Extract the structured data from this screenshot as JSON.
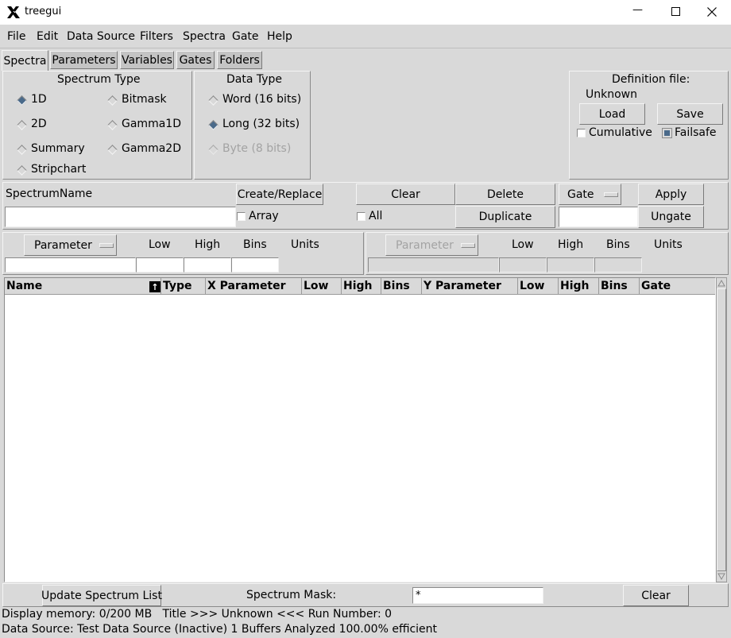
{
  "window": {
    "title": "treegui",
    "minimize_glyph": "—",
    "maximize_glyph": "☐",
    "close_glyph": "✕"
  },
  "menu": [
    "File",
    "Edit",
    "Data Source",
    "Filters",
    "Spectra",
    "Gate",
    "Help"
  ],
  "tabs": [
    "Spectra",
    "Parameters",
    "Variables",
    "Gates",
    "Folders"
  ],
  "spectrum_type": {
    "title": "Spectrum Type",
    "options": [
      "1D",
      "Bitmask",
      "2D",
      "Gamma1D",
      "Summary",
      "Gamma2D",
      "Stripchart"
    ],
    "selected": "1D"
  },
  "data_type": {
    "title": "Data Type",
    "options": [
      "Word (16 bits)",
      "Long (32 bits)",
      "Byte (8 bits)"
    ],
    "selected": "Long (32 bits)"
  },
  "definition": {
    "title": "Definition file:",
    "file": "Unknown",
    "load": "Load",
    "save": "Save",
    "cumulative": "Cumulative",
    "failsafe": "Failsafe"
  },
  "spectrum_row": {
    "name_label": "SpectrumName",
    "name_value": "",
    "create": "Create/Replace",
    "array": "Array",
    "clear": "Clear",
    "all": "All",
    "delete": "Delete",
    "duplicate": "Duplicate",
    "gate": "Gate",
    "gate_value": "",
    "apply": "Apply",
    "ungate": "Ungate"
  },
  "param_x": {
    "parameter": "Parameter",
    "low": "Low",
    "high": "High",
    "bins": "Bins",
    "units": "Units"
  },
  "param_y": {
    "parameter": "Parameter",
    "low": "Low",
    "high": "High",
    "bins": "Bins",
    "units": "Units"
  },
  "table": {
    "sort_glyph": "↑",
    "columns": [
      "Name",
      "Type",
      "X Parameter",
      "Low",
      "High",
      "Bins",
      "Y Parameter",
      "Low",
      "High",
      "Bins",
      "Gate"
    ],
    "rows": []
  },
  "bottom": {
    "update": "Update Spectrum List",
    "mask_label": "Spectrum Mask:",
    "mask_value": "*",
    "clear": "Clear"
  },
  "status": {
    "line1": "Display memory: 0/200 MB   Title >>> Unknown <<< Run Number: 0",
    "line2": "Data Source: Test Data Source (Inactive) 1 Buffers Analyzed 100.00% efficient"
  }
}
